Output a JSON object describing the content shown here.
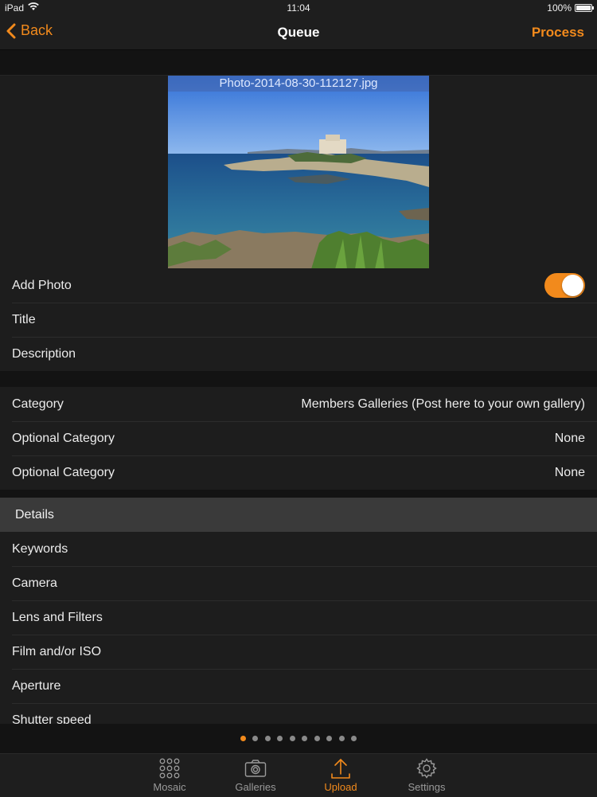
{
  "status_bar": {
    "device": "iPad",
    "time": "11:04",
    "battery": "100%"
  },
  "nav": {
    "back_label": "Back",
    "title": "Queue",
    "action_label": "Process"
  },
  "photo": {
    "filename": "Photo-2014-08-30-112127.jpg"
  },
  "photo_options": {
    "add_photo_label": "Add Photo",
    "add_photo_on": true,
    "title_label": "Title",
    "description_label": "Description"
  },
  "categories": [
    {
      "label": "Category",
      "value": "Members Galleries (Post here to your own gallery)"
    },
    {
      "label": "Optional Category",
      "value": "None"
    },
    {
      "label": "Optional Category",
      "value": "None"
    }
  ],
  "details": {
    "header": "Details",
    "items": [
      {
        "label": "Keywords"
      },
      {
        "label": "Camera"
      },
      {
        "label": "Lens and Filters"
      },
      {
        "label": "Film and/or ISO"
      },
      {
        "label": "Aperture"
      },
      {
        "label": "Shutter speed"
      }
    ]
  },
  "pager": {
    "count": 10,
    "active_index": 0
  },
  "tabs": [
    {
      "label": "Mosaic",
      "icon": "mosaic-grid-icon",
      "active": false
    },
    {
      "label": "Galleries",
      "icon": "camera-icon",
      "active": false
    },
    {
      "label": "Upload",
      "icon": "upload-icon",
      "active": true
    },
    {
      "label": "Settings",
      "icon": "gear-icon",
      "active": false
    }
  ],
  "colors": {
    "accent": "#f28a1c",
    "background": "#131313",
    "cell": "#1d1d1d",
    "section_header": "#3a3a3a"
  }
}
